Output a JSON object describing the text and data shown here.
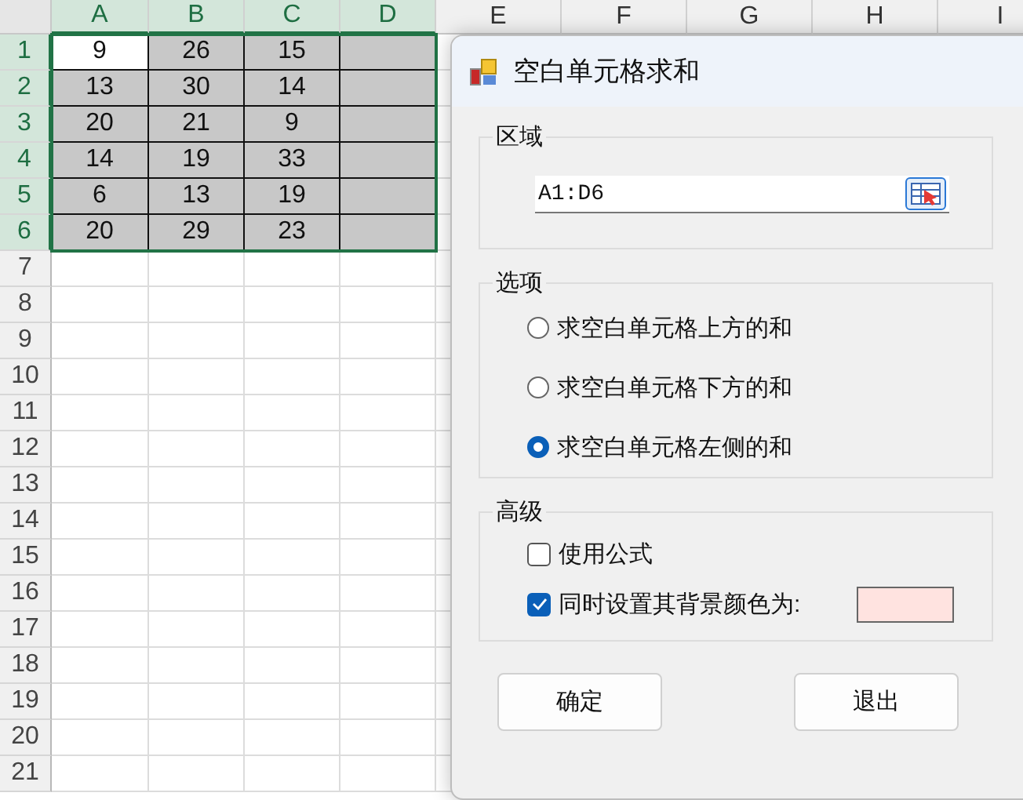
{
  "sheet": {
    "columns": [
      {
        "label": "A",
        "selected": true
      },
      {
        "label": "B",
        "selected": true
      },
      {
        "label": "C",
        "selected": true
      },
      {
        "label": "D",
        "selected": true
      },
      {
        "label": "E",
        "selected": false
      },
      {
        "label": "F",
        "selected": false
      },
      {
        "label": "G",
        "selected": false
      },
      {
        "label": "H",
        "selected": false
      },
      {
        "label": "I",
        "selected": false
      }
    ],
    "rows": [
      {
        "header": "1",
        "selected": true,
        "cells": [
          {
            "value": "9",
            "active": true
          },
          {
            "value": "26",
            "active": false
          },
          {
            "value": "15",
            "active": false
          }
        ]
      },
      {
        "header": "2",
        "selected": true,
        "cells": [
          {
            "value": "13",
            "active": false
          },
          {
            "value": "30",
            "active": false
          },
          {
            "value": "14",
            "active": false
          }
        ]
      },
      {
        "header": "3",
        "selected": true,
        "cells": [
          {
            "value": "20",
            "active": false
          },
          {
            "value": "21",
            "active": false
          },
          {
            "value": "9",
            "active": false
          }
        ]
      },
      {
        "header": "4",
        "selected": true,
        "cells": [
          {
            "value": "14",
            "active": false
          },
          {
            "value": "19",
            "active": false
          },
          {
            "value": "33",
            "active": false
          }
        ]
      },
      {
        "header": "5",
        "selected": true,
        "cells": [
          {
            "value": "6",
            "active": false
          },
          {
            "value": "13",
            "active": false
          },
          {
            "value": "19",
            "active": false
          }
        ]
      },
      {
        "header": "6",
        "selected": true,
        "cells": [
          {
            "value": "20",
            "active": false
          },
          {
            "value": "29",
            "active": false
          },
          {
            "value": "23",
            "active": false
          }
        ]
      },
      {
        "header": "7",
        "selected": false
      },
      {
        "header": "8",
        "selected": false
      },
      {
        "header": "9",
        "selected": false
      },
      {
        "header": "10",
        "selected": false
      },
      {
        "header": "11",
        "selected": false
      },
      {
        "header": "12",
        "selected": false
      },
      {
        "header": "13",
        "selected": false
      },
      {
        "header": "14",
        "selected": false
      },
      {
        "header": "15",
        "selected": false
      },
      {
        "header": "16",
        "selected": false
      },
      {
        "header": "17",
        "selected": false
      },
      {
        "header": "18",
        "selected": false
      },
      {
        "header": "19",
        "selected": false
      },
      {
        "header": "20",
        "selected": false
      },
      {
        "header": "21",
        "selected": false
      }
    ]
  },
  "dialog": {
    "title": "空白单元格求和",
    "region": {
      "label": "区域",
      "value": "A1:D6"
    },
    "options": {
      "label": "选项",
      "items": [
        {
          "label": "求空白单元格上方的和",
          "selected": false
        },
        {
          "label": "求空白单元格下方的和",
          "selected": false
        },
        {
          "label": "求空白单元格左侧的和",
          "selected": true
        }
      ]
    },
    "advanced": {
      "label": "高级",
      "items": [
        {
          "label": "使用公式",
          "checked": false
        },
        {
          "label": "同时设置其背景颜色为:",
          "checked": true,
          "color": "#ffe3e0"
        }
      ]
    },
    "buttons": [
      "确定",
      "退出"
    ]
  }
}
